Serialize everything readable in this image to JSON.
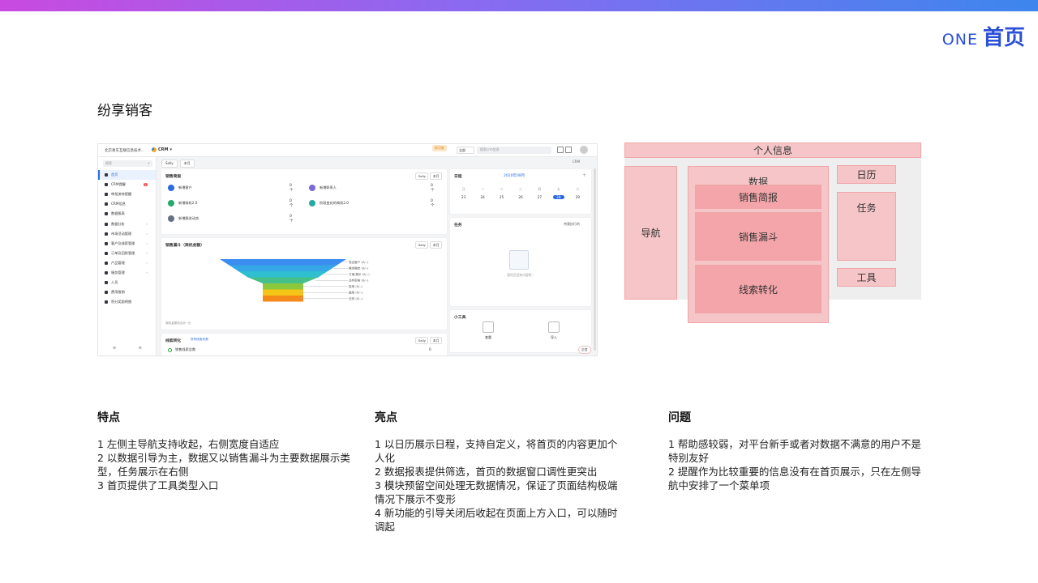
{
  "brand": {
    "en": "ONE",
    "cn": "首页"
  },
  "section_title": "纷享销客",
  "crm": {
    "topbar": {
      "company": "北京易车互联信息技术...",
      "app": "CRM",
      "badge": "新功能",
      "scope": "全部",
      "search_placeholder": "搜索crm信息",
      "notify_count": "1"
    },
    "sidebar": {
      "search": "搜索",
      "items": [
        {
          "label": "首页",
          "active": true
        },
        {
          "label": "CRM提醒",
          "count": "2"
        },
        {
          "label": "审批流待提醒"
        },
        {
          "label": "CRM信息"
        },
        {
          "label": "数据报表"
        },
        {
          "label": "数据分析",
          "arrow": true
        },
        {
          "label": "市场活动管理",
          "arrow": true
        },
        {
          "label": "客户及线索管理",
          "arrow": true
        },
        {
          "label": "订单及回款管理",
          "arrow": true
        },
        {
          "label": "产品管理",
          "arrow": true
        },
        {
          "label": "服务管理",
          "arrow": true
        },
        {
          "label": "人员"
        },
        {
          "label": "费用报销"
        },
        {
          "label": "积分奖励明细"
        }
      ],
      "footer": [
        "≡",
        "≡"
      ]
    },
    "filter": {
      "user": "Sally",
      "period": "本月",
      "right": "CRM"
    },
    "brief": {
      "title": "销售简报",
      "pills": [
        "Sally",
        "本月"
      ],
      "items": [
        {
          "label": "新增客户",
          "value": "0 个",
          "color": "#2a6be0"
        },
        {
          "label": "新增商机2.0",
          "value": "0 个",
          "color": "#25a86b"
        },
        {
          "label": "新增跟进动态",
          "value": "0 个",
          "color": "#667085"
        },
        {
          "label": "新增联系人",
          "value": "0 个",
          "color": "#7a6ad8"
        },
        {
          "label": "阶段变化的商机2.0",
          "value": "0 个",
          "color": "#25a8a0"
        }
      ]
    },
    "funnel": {
      "title": "销售漏斗（商机金额）",
      "pills": [
        "Sally",
        "本月"
      ],
      "note": "商机金额总合计: 元",
      "stages": [
        {
          "label": "验证客户 (0/--)",
          "color": "#3b8ef0"
        },
        {
          "label": "需求确定 (0/--)",
          "color": "#35a6e6"
        },
        {
          "label": "方案/报价 (0/--)",
          "color": "#2fbfd0"
        },
        {
          "label": "谈判审核 (0/--)",
          "color": "#45c08a"
        },
        {
          "label": "赢单 (0/--)",
          "color": "#8cc83c"
        },
        {
          "label": "输单 (0/--)",
          "color": "#f5c518"
        },
        {
          "label": "无效 (0/--)",
          "color": "#f58a1a"
        }
      ]
    },
    "clue": {
      "title": "线索转化",
      "sub": "所有线索来源",
      "pills": [
        "Sally",
        "本月"
      ],
      "row": "销售线索总数",
      "value": "0"
    },
    "calendar": {
      "title": "日程",
      "month": "2020年08月",
      "weekdays": [
        "日",
        "一",
        "二",
        "三",
        "四",
        "五",
        "六"
      ],
      "days": [
        "23",
        "24",
        "25",
        "26",
        "27",
        "28",
        "29"
      ],
      "today": "28"
    },
    "task": {
      "title": "任务",
      "filter": "待我执行的",
      "empty": "暂时还没有内容呢~"
    },
    "tools": {
      "title": "小工具",
      "items": [
        "查重",
        "导入"
      ]
    },
    "float": "企信"
  },
  "wireframe": {
    "profile": "个人信息",
    "nav": "导航",
    "data": "数据",
    "brief": "销售简报",
    "funnel": "销售漏斗",
    "clue": "线索转化",
    "calendar": "日历",
    "task": "任务",
    "tools": "工具"
  },
  "columns": [
    {
      "title": "特点",
      "lines": [
        "1 左侧主导航支持收起，右侧宽度自适应",
        "2 以数据引导为主，数据又以销售漏斗为主要数据展示类型，任务展示在右侧",
        "3 首页提供了工具类型入口"
      ]
    },
    {
      "title": "亮点",
      "lines": [
        "1 以日历展示日程，支持自定义，将首页的内容更加个人化",
        "2 数据报表提供筛选，首页的数据窗口调性更突出",
        "3 模块预留空间处理无数据情况，保证了页面结构极端情况下展示不变形",
        "4 新功能的引导关闭后收起在页面上方入口，可以随时调起"
      ]
    },
    {
      "title": "问题",
      "lines": [
        "1 帮助感较弱，对平台新手或者对数据不满意的用户不是特别友好",
        "2 提醒作为比较重要的信息没有在首页展示，只在左侧导航中安排了一个菜单项"
      ]
    }
  ]
}
